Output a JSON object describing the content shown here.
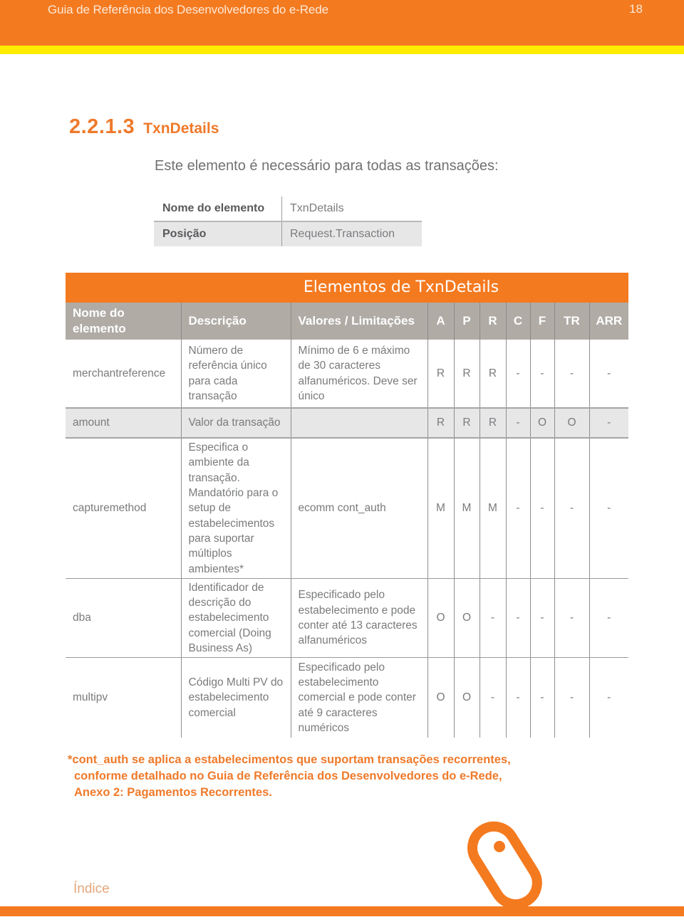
{
  "header": {
    "doc_title": "Guia de Referência dos Desenvolvedores do e-Rede",
    "page_number": "18"
  },
  "section": {
    "number": "2.2.1.3",
    "title": "TxnDetails",
    "intro": "Este elemento é necessário para todas as transações:"
  },
  "info_table": {
    "rows": [
      {
        "label": "Nome do elemento",
        "value": "TxnDetails"
      },
      {
        "label": "Posição",
        "value": "Request.Transaction"
      }
    ]
  },
  "main_table": {
    "band_title": "Elementos de TxnDetails",
    "headers": {
      "name": "Nome do elemento",
      "description": "Descrição",
      "values": "Valores / Limitações",
      "flags": [
        "A",
        "P",
        "R",
        "C",
        "F",
        "TR",
        "ARR"
      ]
    },
    "rows": [
      {
        "name": "merchantreference",
        "description": "Número de referência único para cada transação",
        "values": "Mínimo de 6 e máximo de 30 caracteres alfanuméricos. Deve ser único",
        "flags": [
          "R",
          "R",
          "R",
          "-",
          "-",
          "-",
          "-"
        ]
      },
      {
        "name": "amount",
        "description": "Valor da transação",
        "values": "",
        "flags": [
          "R",
          "R",
          "R",
          "-",
          "O",
          "O",
          "-"
        ]
      },
      {
        "name": "capturemethod",
        "description": "Especifica o ambiente da transação. Mandatório para o setup de estabelecimentos para suportar múltiplos ambientes*",
        "values": "ecomm cont_auth",
        "flags": [
          "M",
          "M",
          "M",
          "-",
          "-",
          "-",
          "-"
        ]
      },
      {
        "name": "dba",
        "description": "Identificador de descrição do estabelecimento comercial (Doing Business As)",
        "values": "Especificado pelo estabelecimento e pode conter até 13 caracteres alfanuméricos",
        "flags": [
          "O",
          "O",
          "-",
          "-",
          "-",
          "-",
          "-"
        ]
      },
      {
        "name": "multipv",
        "description": "Código Multi PV do estabelecimento comercial",
        "values": "Especificado pelo estabelecimento comercial e pode conter até 9 caracteres numéricos",
        "flags": [
          "O",
          "O",
          "-",
          "-",
          "-",
          "-",
          "-"
        ]
      }
    ]
  },
  "footnote": {
    "line1": "*cont_auth se aplica a estabelecimentos que suportam transações recorrentes,",
    "line2": "conforme detalhado no Guia de Referência dos Desenvolvedores do e-Rede,",
    "line3": "Anexo 2: Pagamentos Recorrentes."
  },
  "footer": {
    "index_link": "Índice",
    "logo_icon": "mouse-icon"
  },
  "colors": {
    "brand_orange": "#f47a20",
    "accent_yellow": "#ffec00",
    "header_gray": "#b0aba5",
    "row_gray": "#e7e7e8"
  }
}
